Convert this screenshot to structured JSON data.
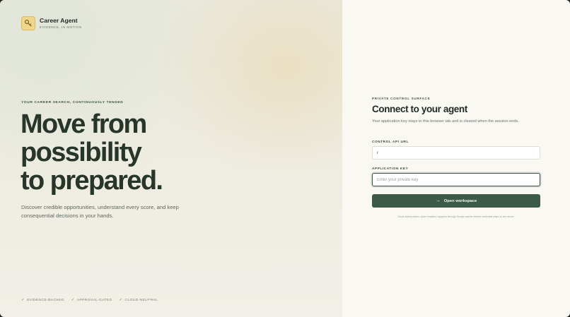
{
  "brand": {
    "name": "Career Agent",
    "tagline": "EVIDENCE, IN MOTION",
    "icon": "key-icon",
    "accent": "#efd689"
  },
  "hero": {
    "eyebrow": "YOUR CAREER SEARCH, CONTINUOUSLY TENDED",
    "headline_lines": [
      "Move from",
      "possibility",
      "to prepared."
    ],
    "subcopy": "Discover credible opportunities, understand every score, and keep consequential decisions in your hands."
  },
  "badges": [
    {
      "label": "EVIDENCE-BACKED",
      "icon": "check-icon"
    },
    {
      "label": "APPROVAL-GATED",
      "icon": "check-icon"
    },
    {
      "label": "CLOUD-NEUTRAL",
      "icon": "check-icon"
    }
  ],
  "form": {
    "eyebrow": "PRIVATE CONTROL SURFACE",
    "title": "Connect to your agent",
    "description": "Your application key stays in this browser tab and is cleared when the session ends.",
    "url_label": "CONTROL API URL",
    "url_value": "/",
    "key_label": "APPLICATION KEY",
    "key_placeholder": "Enter your private key",
    "key_value": "",
    "submit_label": "Open workspace",
    "submit_icon": "arrow-right-icon",
    "footnote": "Gmail authorization, when enabled, happens through Google and its refresh credential stays on the server."
  },
  "colors": {
    "primary": "#3b5a47",
    "headline": "#27352b",
    "panel": "#f9f8f3"
  }
}
